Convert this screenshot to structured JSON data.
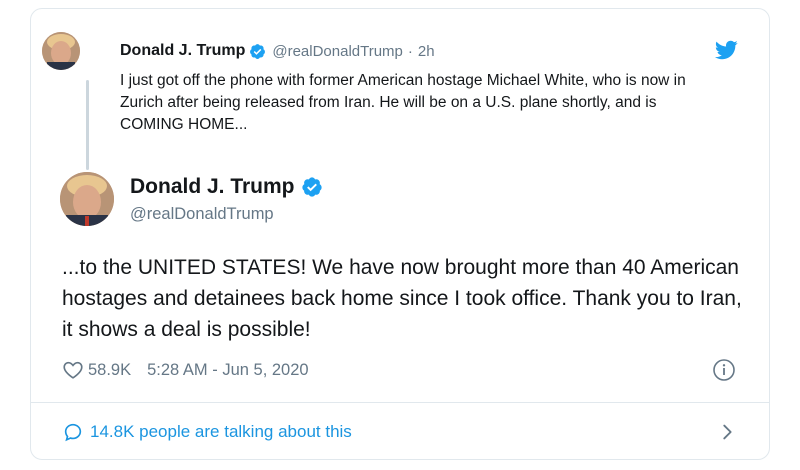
{
  "parent_tweet": {
    "author_name": "Donald J. Trump",
    "handle": "@realDonaldTrump",
    "separator": "·",
    "time": "2h",
    "text": "I just got off the phone with former American hostage Michael White, who is now in Zurich after being released from Iran. He will be on a U.S. plane shortly, and is COMING HOME..."
  },
  "main_tweet": {
    "author_name": "Donald J. Trump",
    "handle": "@realDonaldTrump",
    "text": "...to the UNITED STATES! We have now brought more than 40 American hostages and detainees back home since I took office. Thank you to Iran, it shows a deal is possible!",
    "like_count": "58.9K",
    "timestamp": "5:28 AM - Jun 5, 2020"
  },
  "footer": {
    "talking_text": "14.8K people are talking about this"
  },
  "icons": {
    "twitter": "twitter-bird-icon",
    "verified": "verified-badge-icon",
    "like": "heart-icon",
    "info": "info-icon",
    "reply": "speech-bubble-icon",
    "chevron": "chevron-right-icon"
  },
  "colors": {
    "accent": "#1da1f2",
    "link": "#1b95e0",
    "secondary_text": "#657786",
    "border": "#e1e8ed"
  }
}
